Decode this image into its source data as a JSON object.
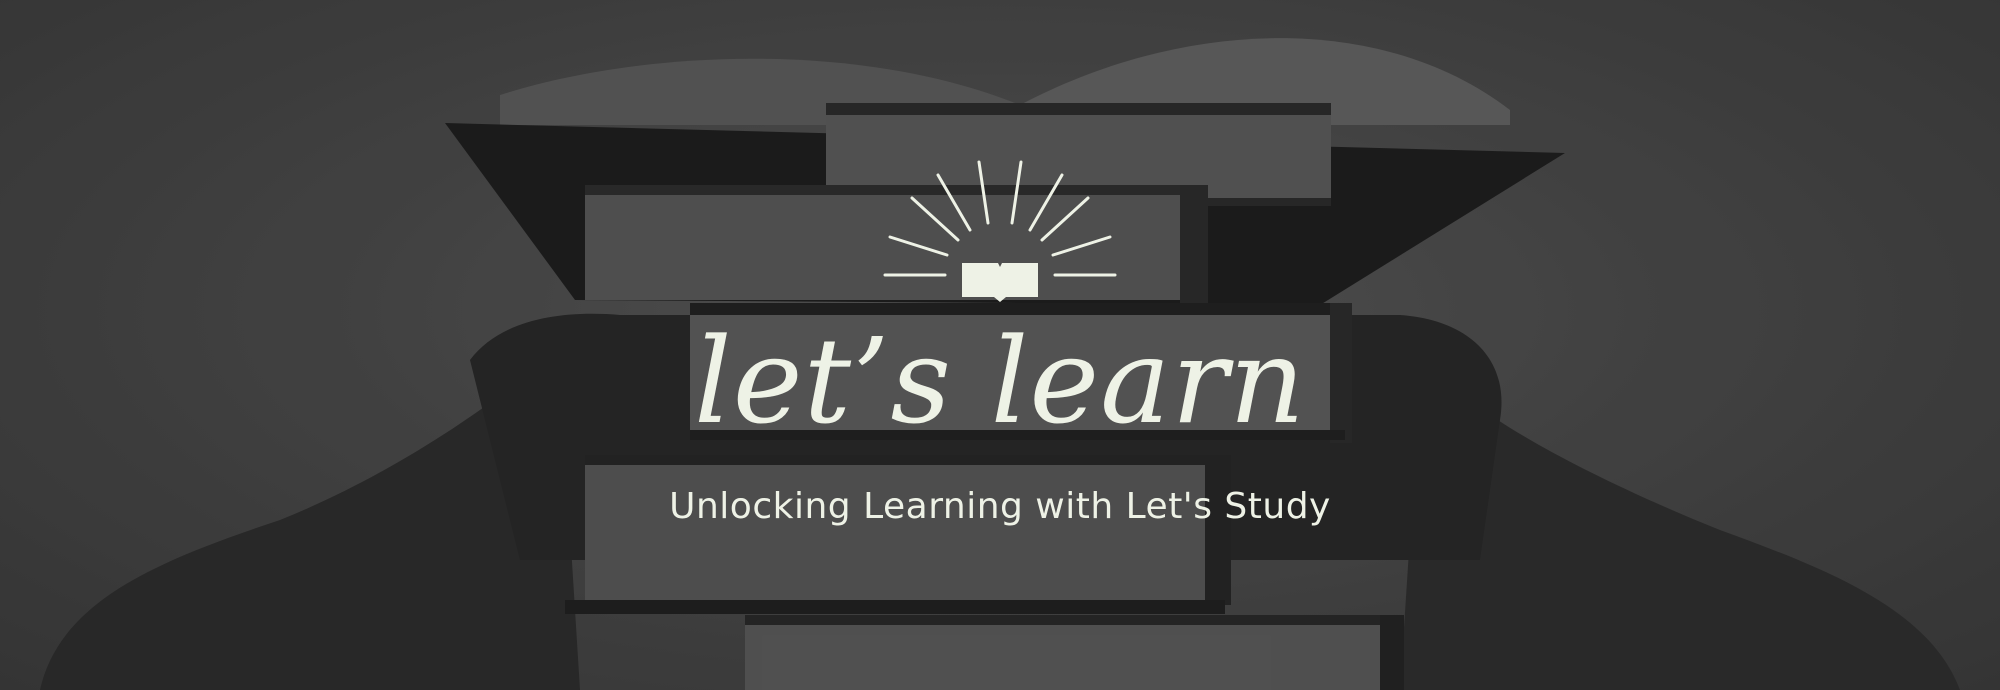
{
  "banner": {
    "headline": "let’s learn",
    "tagline": "Unlocking Learning with Let's Study",
    "logo_icon": "open-book-sunburst-icon",
    "background": "stacked-books-photo"
  },
  "colors": {
    "text": "#eef2e6",
    "background": "#4a4a4a"
  }
}
